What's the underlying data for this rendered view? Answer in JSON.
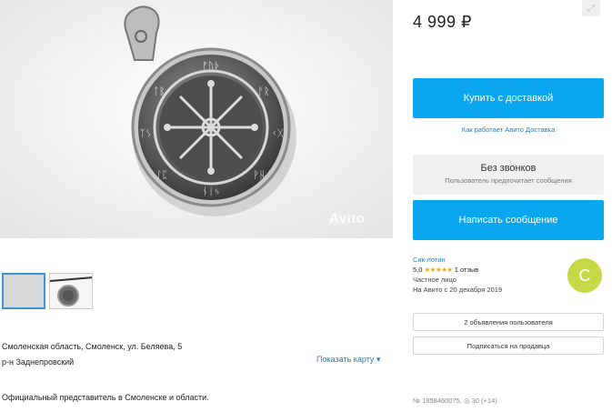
{
  "listing": {
    "watermark": "Avito",
    "address_line1": "Смоленская область, Смоленск, ул. Беляева, 5",
    "address_line2": "р-н Заднепровский",
    "show_map": "Показать карту ▾",
    "description": "Официальный представитель в Смоленске и области."
  },
  "sidebar": {
    "price": "4 999 ₽",
    "buy_label": "Купить с доставкой",
    "delivery_note": "Как работает Авито Доставка",
    "no_calls_title": "Без звонков",
    "no_calls_sub": "Пользователь предпочитает сообщения",
    "message_label": "Написать сообщение",
    "seller": {
      "name": "Сик-лотин",
      "rating": "5,0",
      "stars": "★★★★★",
      "reviews": "1 отзыв",
      "type": "Частное лицо",
      "since": "На Авито с 20 декабря 2019",
      "avatar_letter": "C",
      "avatar_color": "#c6d845"
    },
    "user_ads_label": "2 объявления пользователя",
    "subscribe_label": "Подписаться на продавца",
    "item_meta": "№ 1858460075, ◎ 30 (+14)"
  },
  "colors": {
    "accent": "#0aa7f0",
    "link": "#2c7cc0"
  },
  "icons": {
    "corner": "expand-icon"
  }
}
